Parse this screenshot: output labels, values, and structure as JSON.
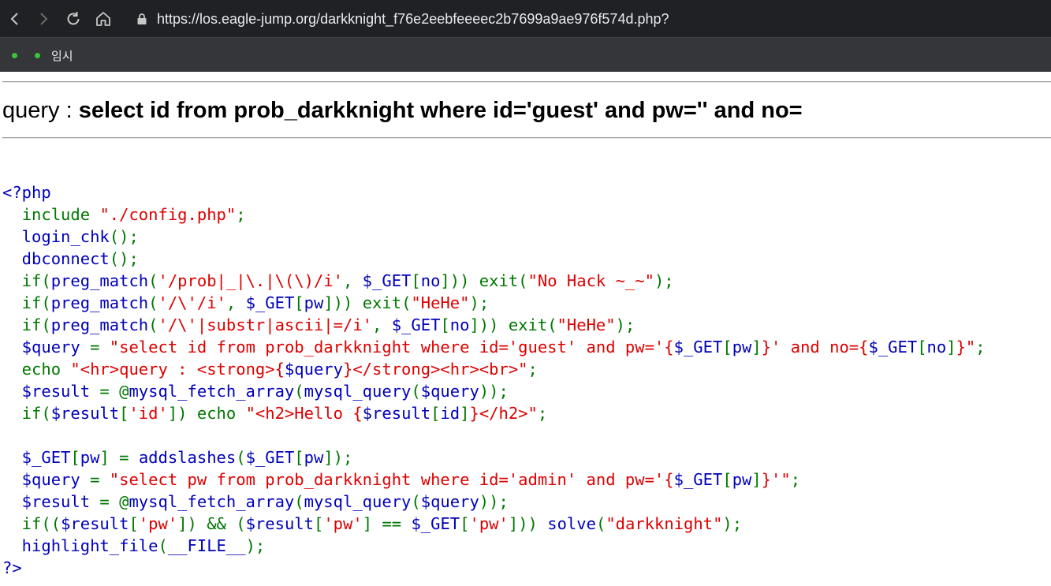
{
  "browser": {
    "url": "https://los.eagle-jump.org/darkknight_f76e2eebfeeeec2b7699a9ae976f574d.php?",
    "bookmarks": [
      {
        "label": ""
      },
      {
        "label": "임시"
      }
    ]
  },
  "page": {
    "query_prefix": "query : ",
    "query_text": "select id from prob_darkknight where id='guest' and pw='' and no="
  },
  "colors": {
    "default": "#0000BB",
    "keyword": "#007700",
    "string": "#DD0000",
    "html": "#000000"
  },
  "code_lines": [
    [
      [
        "def",
        "<?php"
      ]
    ],
    [
      [
        "def",
        "  "
      ],
      [
        "kw",
        "include "
      ],
      [
        "str",
        "\"./config.php\""
      ],
      [
        "kw",
        ";"
      ]
    ],
    [
      [
        "def",
        "  login_chk"
      ],
      [
        "kw",
        "();"
      ]
    ],
    [
      [
        "def",
        "  dbconnect"
      ],
      [
        "kw",
        "();"
      ]
    ],
    [
      [
        "kw",
        "  if("
      ],
      [
        "def",
        "preg_match"
      ],
      [
        "kw",
        "("
      ],
      [
        "str",
        "'/prob|_|\\.|\\(\\)/i'"
      ],
      [
        "kw",
        ", "
      ],
      [
        "def",
        "$_GET"
      ],
      [
        "kw",
        "["
      ],
      [
        "def",
        "no"
      ],
      [
        "kw",
        "])) exit("
      ],
      [
        "str",
        "\"No Hack ~_~\""
      ],
      [
        "kw",
        ");"
      ]
    ],
    [
      [
        "kw",
        "  if("
      ],
      [
        "def",
        "preg_match"
      ],
      [
        "kw",
        "("
      ],
      [
        "str",
        "'/\\'/i'"
      ],
      [
        "kw",
        ", "
      ],
      [
        "def",
        "$_GET"
      ],
      [
        "kw",
        "["
      ],
      [
        "def",
        "pw"
      ],
      [
        "kw",
        "])) exit("
      ],
      [
        "str",
        "\"HeHe\""
      ],
      [
        "kw",
        ");"
      ]
    ],
    [
      [
        "kw",
        "  if("
      ],
      [
        "def",
        "preg_match"
      ],
      [
        "kw",
        "("
      ],
      [
        "str",
        "'/\\'|substr|ascii|=/i'"
      ],
      [
        "kw",
        ", "
      ],
      [
        "def",
        "$_GET"
      ],
      [
        "kw",
        "["
      ],
      [
        "def",
        "no"
      ],
      [
        "kw",
        "])) exit("
      ],
      [
        "str",
        "\"HeHe\""
      ],
      [
        "kw",
        ");"
      ]
    ],
    [
      [
        "def",
        "  $query "
      ],
      [
        "kw",
        "= "
      ],
      [
        "str",
        "\"select id from prob_darkknight where id='guest' and pw='{"
      ],
      [
        "def",
        "$_GET"
      ],
      [
        "kw",
        "["
      ],
      [
        "def",
        "pw"
      ],
      [
        "kw",
        "]"
      ],
      [
        "str",
        "}' and no={"
      ],
      [
        "def",
        "$_GET"
      ],
      [
        "kw",
        "["
      ],
      [
        "def",
        "no"
      ],
      [
        "kw",
        "]"
      ],
      [
        "str",
        "}\""
      ],
      [
        "kw",
        ";"
      ]
    ],
    [
      [
        "kw",
        "  echo "
      ],
      [
        "str",
        "\"<hr>query : <strong>{"
      ],
      [
        "def",
        "$query"
      ],
      [
        "str",
        "}</strong><hr><br>\""
      ],
      [
        "kw",
        ";"
      ]
    ],
    [
      [
        "def",
        "  $result "
      ],
      [
        "kw",
        "= @"
      ],
      [
        "def",
        "mysql_fetch_array"
      ],
      [
        "kw",
        "("
      ],
      [
        "def",
        "mysql_query"
      ],
      [
        "kw",
        "("
      ],
      [
        "def",
        "$query"
      ],
      [
        "kw",
        "));"
      ]
    ],
    [
      [
        "kw",
        "  if("
      ],
      [
        "def",
        "$result"
      ],
      [
        "kw",
        "["
      ],
      [
        "str",
        "'id'"
      ],
      [
        "kw",
        "]) echo "
      ],
      [
        "str",
        "\"<h2>Hello {"
      ],
      [
        "def",
        "$result"
      ],
      [
        "kw",
        "["
      ],
      [
        "def",
        "id"
      ],
      [
        "kw",
        "]"
      ],
      [
        "str",
        "}</h2>\""
      ],
      [
        "kw",
        ";"
      ]
    ],
    [
      [
        "def",
        ""
      ]
    ],
    [
      [
        "def",
        "  $_GET"
      ],
      [
        "kw",
        "["
      ],
      [
        "def",
        "pw"
      ],
      [
        "kw",
        "] = "
      ],
      [
        "def",
        "addslashes"
      ],
      [
        "kw",
        "("
      ],
      [
        "def",
        "$_GET"
      ],
      [
        "kw",
        "["
      ],
      [
        "def",
        "pw"
      ],
      [
        "kw",
        "]);"
      ]
    ],
    [
      [
        "def",
        "  $query "
      ],
      [
        "kw",
        "= "
      ],
      [
        "str",
        "\"select pw from prob_darkknight where id='admin' and pw='{"
      ],
      [
        "def",
        "$_GET"
      ],
      [
        "kw",
        "["
      ],
      [
        "def",
        "pw"
      ],
      [
        "kw",
        "]"
      ],
      [
        "str",
        "}'\""
      ],
      [
        "kw",
        ";"
      ]
    ],
    [
      [
        "def",
        "  $result "
      ],
      [
        "kw",
        "= @"
      ],
      [
        "def",
        "mysql_fetch_array"
      ],
      [
        "kw",
        "("
      ],
      [
        "def",
        "mysql_query"
      ],
      [
        "kw",
        "("
      ],
      [
        "def",
        "$query"
      ],
      [
        "kw",
        "));"
      ]
    ],
    [
      [
        "kw",
        "  if(("
      ],
      [
        "def",
        "$result"
      ],
      [
        "kw",
        "["
      ],
      [
        "str",
        "'pw'"
      ],
      [
        "kw",
        "]) && ("
      ],
      [
        "def",
        "$result"
      ],
      [
        "kw",
        "["
      ],
      [
        "str",
        "'pw'"
      ],
      [
        "kw",
        "] == "
      ],
      [
        "def",
        "$_GET"
      ],
      [
        "kw",
        "["
      ],
      [
        "str",
        "'pw'"
      ],
      [
        "kw",
        "])) "
      ],
      [
        "def",
        "solve"
      ],
      [
        "kw",
        "("
      ],
      [
        "str",
        "\"darkknight\""
      ],
      [
        "kw",
        ");"
      ]
    ],
    [
      [
        "def",
        "  highlight_file"
      ],
      [
        "kw",
        "("
      ],
      [
        "def",
        "__FILE__"
      ],
      [
        "kw",
        ");"
      ]
    ],
    [
      [
        "def",
        "?>"
      ]
    ]
  ]
}
